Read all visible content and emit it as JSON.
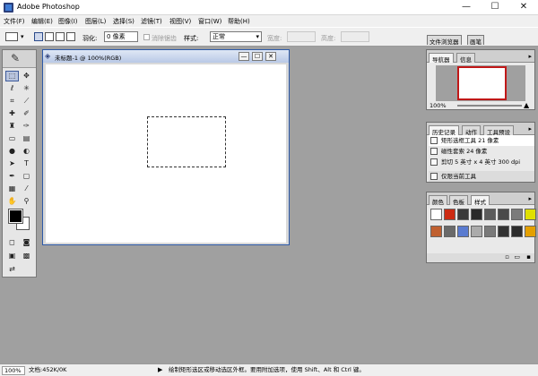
{
  "window": {
    "title": "Adobe Photoshop",
    "minimize": "—",
    "maximize": "☐",
    "close": "✕"
  },
  "menu": [
    "文件(F)",
    "编辑(E)",
    "图像(I)",
    "图层(L)",
    "选择(S)",
    "滤镜(T)",
    "视图(V)",
    "窗口(W)",
    "帮助(H)"
  ],
  "options": {
    "feather_label": "羽化:",
    "feather_value": "0 像素",
    "antialias_label": "消除锯齿",
    "style_label": "样式:",
    "style_value": "正常",
    "width_label": "宽度:",
    "height_label": "高度:",
    "well_tabs": [
      "文件浏览器",
      "画笔"
    ]
  },
  "document": {
    "title": "未标题-1 @ 100%(RGB)",
    "minimize": "—",
    "maximize": "☐",
    "close": "✕"
  },
  "navigator": {
    "tabs": [
      "导航器",
      "信息"
    ],
    "zoom": "100%"
  },
  "history": {
    "tabs": [
      "历史记录",
      "动作",
      "工具预设"
    ],
    "items": [
      "矩形选框工具 21 像素",
      "磁性套索 24 像素",
      "剪切 5 英寸 x 4 英寸 300 dpi",
      "仅限当前工具"
    ]
  },
  "styles": {
    "tabs": [
      "颜色",
      "色板",
      "样式"
    ],
    "swatches": [
      "#ffffff",
      "#cc2a12",
      "#3a3a3a",
      "#2a2a2a",
      "#5b5b5b",
      "#4a4a4a",
      "#7b7b7b",
      "#e0e000",
      "#c06030",
      "#6a6a6a",
      "#5a7bd0",
      "#ababab",
      "#7a7a7a",
      "#333333",
      "#2c2c2c",
      "#e4a000"
    ]
  },
  "status": {
    "zoom": "100%",
    "doc_info": "文档:452K/0K",
    "hint": "绘制矩形选区或移动选区外框。要用附加选项，使用 Shift、Alt 和 Ctrl 键。"
  },
  "colors": {
    "workspace": "#a0a0a0",
    "accent": "#2d5aa8"
  }
}
